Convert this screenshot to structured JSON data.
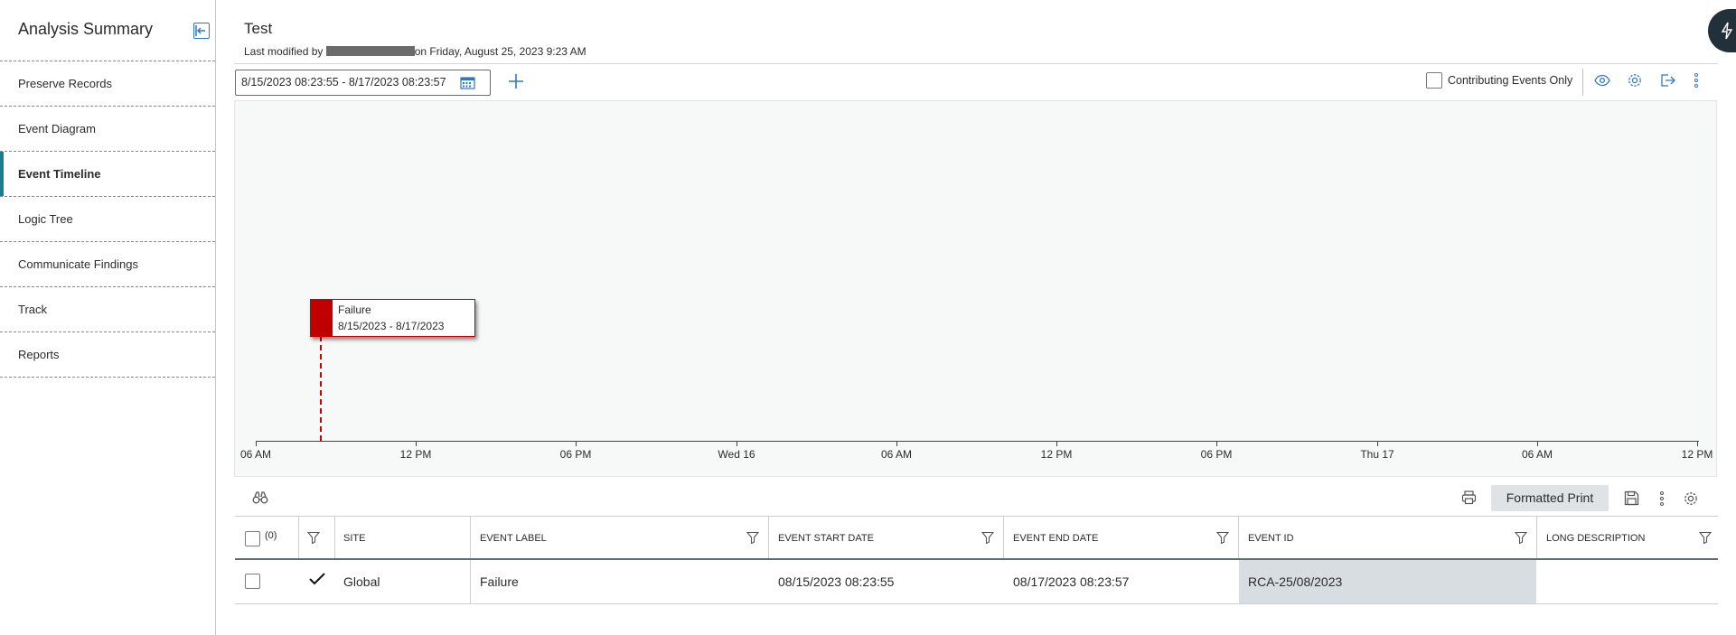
{
  "sidebar": {
    "title": "Analysis Summary",
    "items": [
      {
        "label": "Preserve Records"
      },
      {
        "label": "Event Diagram"
      },
      {
        "label": "Event Timeline"
      },
      {
        "label": "Logic Tree"
      },
      {
        "label": "Communicate Findings"
      },
      {
        "label": "Track"
      },
      {
        "label": "Reports"
      }
    ],
    "active": "Event Timeline"
  },
  "header": {
    "title": "Test",
    "modified_prefix": "Last modified by",
    "modified_suffix": "on Friday, August 25, 2023 9:23 AM"
  },
  "toolbar": {
    "date_range": "8/15/2023 08:23:55  -  8/17/2023 08:23:57",
    "contributing_label": "Contributing Events Only",
    "contributing_checked": false
  },
  "timeline": {
    "ticks": [
      "06 AM",
      "12 PM",
      "06 PM",
      "Wed 16",
      "06 AM",
      "12 PM",
      "06 PM",
      "Thu 17",
      "06 AM",
      "12 PM"
    ],
    "events": [
      {
        "label": "Failure",
        "range": "8/15/2023 - 8/17/2023",
        "color": "#c00000"
      }
    ]
  },
  "grid": {
    "print_label": "Formatted Print",
    "select_count": "(0)",
    "columns": [
      "SITE",
      "EVENT LABEL",
      "EVENT START DATE",
      "EVENT END DATE",
      "EVENT ID",
      "LONG DESCRIPTION"
    ],
    "rows": [
      {
        "site": "Global",
        "event_label": "Failure",
        "start": "08/15/2023 08:23:55",
        "end": "08/17/2023 08:23:57",
        "event_id": "RCA-25/08/2023",
        "long_description": ""
      }
    ]
  },
  "colors": {
    "accent": "#1e7c8c",
    "icon_blue": "#2f79c2",
    "event_red": "#c00000"
  }
}
